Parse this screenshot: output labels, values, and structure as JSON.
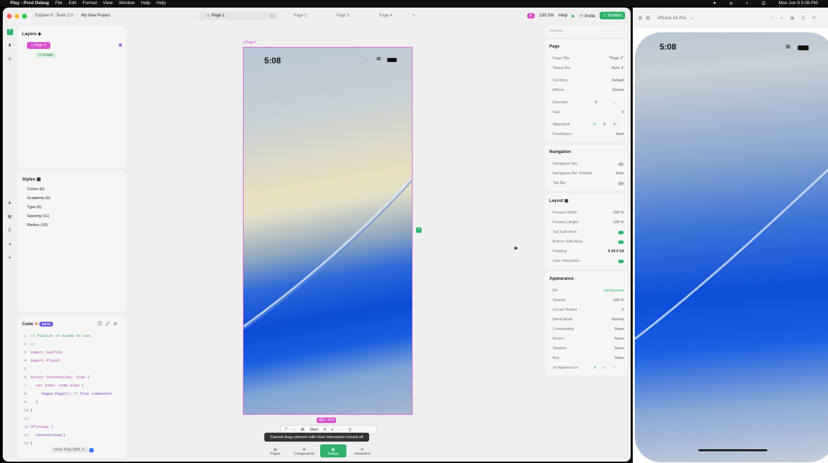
{
  "menubar": {
    "app": "Play - Prod Debug",
    "items": [
      "File",
      "Edit",
      "Format",
      "View",
      "Window",
      "Help",
      "Help"
    ],
    "clock": "Mon Jun 9  5:08 PM"
  },
  "titlebar": {
    "breadcrumb_team": "Explore P...Team 2.0",
    "breadcrumb_project": "My New Project",
    "tabs": [
      "Page 1",
      "Page 2",
      "Page 3",
      "Page 4"
    ],
    "add_tab": "+",
    "zoom": "130.3%",
    "help": "Help",
    "invite": "Invite",
    "publish": "Publish",
    "avatar": "K"
  },
  "layers": {
    "title": "Layers",
    "page": "Page 1",
    "image": "Image"
  },
  "styles": {
    "title": "Styles",
    "items": [
      "Colors (0)",
      "Gradients (0)",
      "Type (0)",
      "Spacing (11)",
      "Radius (10)"
    ]
  },
  "code": {
    "title": "Code",
    "badge": "BETA",
    "lines": [
      "// Publish to Xcode to use.",
      "//",
      "import SwiftUI",
      "import PlayUI",
      "",
      "struct ContentView: View {",
      "var body: some View {",
      "Pages.Page1() // Play component",
      "}",
      "}",
      "",
      "#Preview {",
      "ContentView()",
      "}"
    ],
    "view_select": "View: Play SDK"
  },
  "canvas": {
    "page_label": "Page 1",
    "time": "5:08",
    "dims": "402 × 874",
    "toolbar_start": "Start",
    "toolbar_value": "0",
    "toast": "Cannot drag element with User Interaction turned off"
  },
  "bottomnav": [
    "Pages",
    "Components",
    "Design",
    "Interaction"
  ],
  "inspector": {
    "canvas_label": "Canvas",
    "page": {
      "title": "Page",
      "rows": [
        [
          "Page Title",
          "\"Page 1\""
        ],
        [
          "Status Bar",
          "Auto"
        ],
        [
          "Scrolling",
          "Default"
        ],
        [
          "Effects",
          "(None)"
        ],
        [
          "Direction",
          ""
        ],
        [
          "Gap",
          "0"
        ],
        [
          "Alignment",
          ""
        ],
        [
          "Distribution",
          "Start"
        ]
      ]
    },
    "navigation": {
      "title": "Navigation",
      "rows": [
        [
          "Navigation Bar",
          ""
        ],
        [
          "Navigation Bar Visibility",
          "Auto"
        ],
        [
          "Tab Bar",
          ""
        ]
      ]
    },
    "layout": {
      "title": "Layout",
      "rows": [
        [
          "Preview Width",
          "100 %"
        ],
        [
          "Preview Height",
          "100 %"
        ],
        [
          "Top Safe Area",
          ""
        ],
        [
          "Bottom Safe Area",
          ""
        ],
        [
          "Padding",
          "0  24  0  24"
        ],
        [
          "User Interaction",
          ""
        ]
      ]
    },
    "appearance": {
      "title": "Appearance",
      "rows": [
        [
          "BG",
          "background"
        ],
        [
          "Opacity",
          "100 %"
        ],
        [
          "Corner Radius",
          "0"
        ],
        [
          "Blend Mode",
          "Normal"
        ],
        [
          "Compositing",
          "None"
        ],
        [
          "Border",
          "None"
        ],
        [
          "Shadow",
          "None"
        ],
        [
          "Blur",
          "None"
        ],
        [
          "UI Appearance",
          "A"
        ]
      ]
    }
  },
  "simulator": {
    "device": "iPhone 16 Pro",
    "time": "5:08"
  },
  "colors": {
    "accent": "#2fb36b",
    "pink": "#d94fcd"
  }
}
